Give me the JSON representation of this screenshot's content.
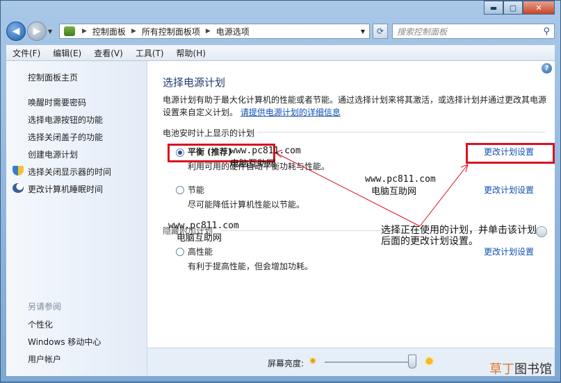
{
  "window": {
    "caption": {
      "minimize": "▬",
      "maximize": "▢",
      "close": "✕"
    }
  },
  "nav": {
    "back_icon": "back-arrow-icon",
    "forward_icon": "forward-arrow-icon",
    "breadcrumbs": [
      "控制面板",
      "所有控制面板项",
      "电源选项"
    ],
    "search_placeholder": "搜索控制面板"
  },
  "menu": [
    "文件(F)",
    "编辑(E)",
    "查看(V)",
    "工具(T)",
    "帮助(H)"
  ],
  "sidebar": {
    "home": "控制面板主页",
    "links": [
      "唤醒时需要密码",
      "选择电源按钮的功能",
      "选择关闭盖子的功能",
      "创建电源计划",
      "选择关闭显示器的时间",
      "更改计算机睡眠时间"
    ],
    "see_also_title": "另请参阅",
    "see_also": [
      "个性化",
      "Windows 移动中心",
      "用户帐户"
    ]
  },
  "main": {
    "title": "选择电源计划",
    "desc_line1": "电源计划有助于最大化计算机的性能或者节能。通过选择计划来将其激活，或选择计划并通过更改其电源",
    "desc_line2": "设置来自定义计划。",
    "desc_link": "请提供电源计划的详细信息",
    "group_heading": "电池安时计上显示的计划",
    "hidden_group_heading": "隐藏附加计划",
    "plans": [
      {
        "name": "平衡 (推荐)",
        "desc": "利用可用的硬件自动平衡功耗与性能。",
        "selected": true
      },
      {
        "name": "节能",
        "desc": "尽可能降低计算机性能以节能。",
        "selected": false
      },
      {
        "name": "高性能",
        "desc": "有利于提高性能，但会增加功耗。",
        "selected": false
      }
    ],
    "change_link": "更改计划设置",
    "brightness_label": "屏幕亮度:",
    "brightness_level": 0.92
  },
  "annotations": {
    "url": "www.pc811.com",
    "site": "电脑互助网",
    "note_line1": "选择正在使用的计划，并单击该计划",
    "note_line2": "后面的更改计划设置。"
  },
  "watermark": {
    "accent": "草丁",
    "rest": "图书馆"
  },
  "colors": {
    "accent_red": "#d8141f",
    "link_blue": "#0f4fb5"
  }
}
